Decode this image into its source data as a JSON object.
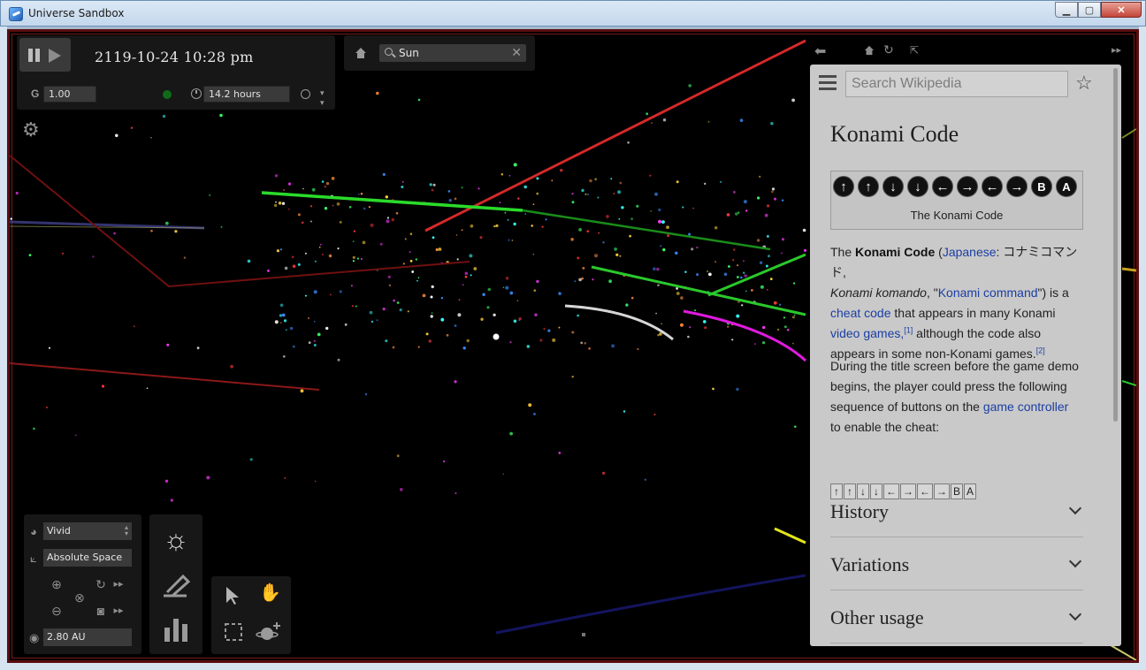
{
  "window": {
    "title": "Universe Sandbox"
  },
  "time": {
    "date": "2119-10-24 10:28 pm",
    "g_label": "G",
    "g_value": "1.00",
    "time_step": "14.2 hours"
  },
  "search": {
    "value": "Sun"
  },
  "view": {
    "color_mode": "Vivid",
    "reference_frame": "Absolute Space",
    "distance": "2.80 AU"
  },
  "wiki": {
    "search_placeholder": "Search Wikipedia",
    "title": "Konami Code",
    "caption": "The Konami Code",
    "buttons": [
      "↑",
      "↑",
      "↓",
      "↓",
      "←",
      "→",
      "←",
      "→",
      "B",
      "A"
    ],
    "p1": {
      "t1": "The ",
      "b1": "Konami Code",
      "t2": " (",
      "l1": "Japanese",
      "t3": ": コナミコマンド,",
      "i1": "Konami komando",
      "t4": ", \"",
      "l2": "Konami command",
      "t5": "\") is a",
      "l3": "cheat code",
      "t6": " that appears in many Konami",
      "l4": "video games,",
      "s1": "[1]",
      "t7": " although the code also",
      "t8": "appears in some non-Konami games.",
      "s2": "[2]"
    },
    "p2": {
      "t1": "During the title screen before the game demo",
      "t2": "begins, the player could press the following",
      "t3": "sequence of buttons on the ",
      "l1": "game controller",
      "t4": "to enable the cheat:"
    },
    "keys": [
      "↑",
      "↑",
      "↓",
      "↓",
      "←",
      "→",
      "←",
      "→",
      "B",
      "A"
    ],
    "sections": [
      "History",
      "Variations",
      "Other usage"
    ]
  }
}
